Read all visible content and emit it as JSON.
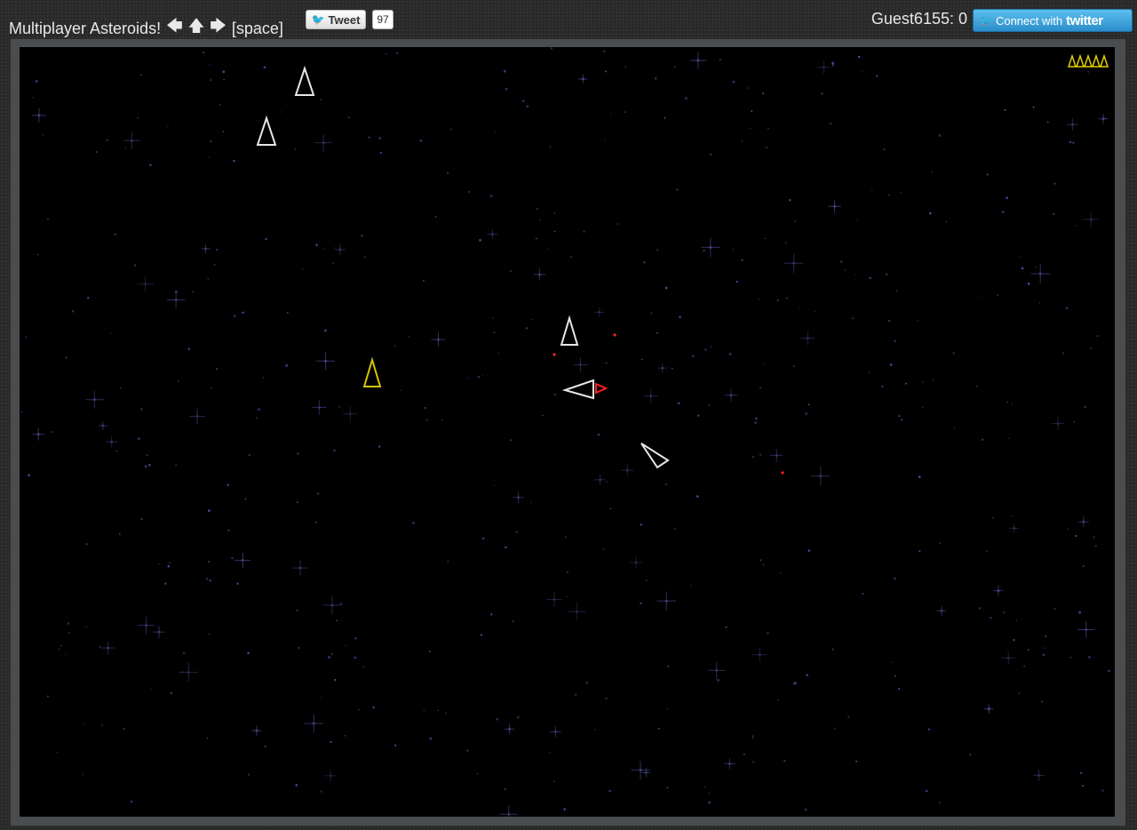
{
  "header": {
    "title": "Multiplayer Asteroids!",
    "controls": {
      "left_arrow": "🡄",
      "up_arrow": "🡅",
      "right_arrow": "🡆",
      "space_key": "[space]"
    },
    "tweet_button_label": "Tweet",
    "tweet_count": "97",
    "user_score": "Guest6155: 0",
    "connect_label": "Connect with",
    "connect_brand": "twitter"
  },
  "game": {
    "lives_remaining": 5,
    "colors": {
      "player_ship": "#d4c400",
      "other_ship": "#e6e6e6",
      "bullet": "#ff2020",
      "lives": "#e0d000",
      "background": "#000000",
      "star": "#4a4a9a"
    },
    "ships": [
      {
        "name": "opponent-ship",
        "angle": 0
      },
      {
        "name": "opponent-ship",
        "angle": 0
      },
      {
        "name": "opponent-ship",
        "angle": 0
      },
      {
        "name": "player-ship",
        "angle": 0
      },
      {
        "name": "opponent-ship",
        "angle": -90
      },
      {
        "name": "opponent-ship",
        "angle": -55
      }
    ]
  }
}
